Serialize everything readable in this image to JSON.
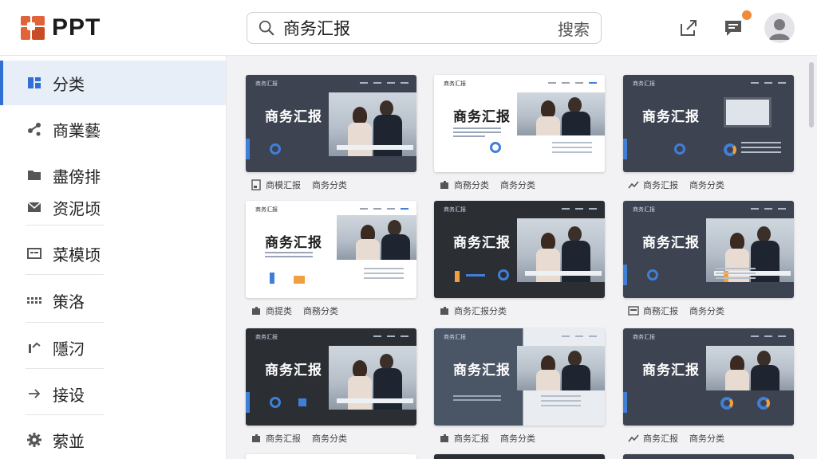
{
  "brand": {
    "name": "PPT",
    "accent": "#e0633a"
  },
  "search": {
    "value": "商务汇报",
    "button_label": "搜索"
  },
  "header_icons": [
    "share-icon",
    "message-icon",
    "avatar-icon"
  ],
  "sidebar": {
    "active_color": "#2f6fd6",
    "items": [
      {
        "label": "分类",
        "icon": "category-icon"
      },
      {
        "label": "商業藝",
        "icon": "share-node-icon"
      },
      {
        "label": "盡傍排",
        "icon": "folder-icon"
      },
      {
        "label": "资泥顷",
        "icon": "mail-icon"
      },
      {
        "label": "菜模顷",
        "icon": "card-icon"
      },
      {
        "label": "策洛",
        "icon": "dots-icon"
      },
      {
        "label": "隱汈",
        "icon": "chart-icon"
      },
      {
        "label": "接设",
        "icon": "arrow-right-icon"
      },
      {
        "label": "萦並",
        "icon": "gear-icon"
      }
    ]
  },
  "templates": [
    {
      "title": "商务汇报",
      "header": "商务汇报",
      "meta": "商模汇报",
      "tag": "商务分类"
    },
    {
      "title": "商务汇报",
      "header": "商务汇报",
      "meta": "商務分类",
      "tag": "商务分类"
    },
    {
      "title": "商务汇报",
      "header": "商务汇报",
      "meta": "商务汇报",
      "tag": "商务分类"
    },
    {
      "title": "商务汇报",
      "header": "商务汇报",
      "meta": "商提类",
      "tag": "商務分类"
    },
    {
      "title": "商务汇报",
      "header": "商务汇报",
      "meta": "商务汇报分类",
      "tag": ""
    },
    {
      "title": "商务汇报",
      "header": "商务汇报",
      "meta": "商務汇报",
      "tag": "商务分类"
    },
    {
      "title": "商务汇报",
      "header": "商务汇报",
      "meta": "商务汇报",
      "tag": "商务分类"
    },
    {
      "title": "商务汇报",
      "header": "商务汇报",
      "meta": "商务汇报",
      "tag": "商务分类"
    },
    {
      "title": "商务汇报",
      "header": "商务汇报",
      "meta": "商务汇报",
      "tag": "商务分类"
    }
  ]
}
